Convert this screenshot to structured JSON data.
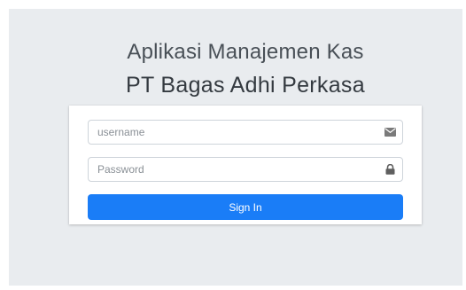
{
  "header": {
    "app_title": "Aplikasi Manajemen Kas",
    "company_name": "PT Bagas Adhi Perkasa"
  },
  "form": {
    "username": {
      "placeholder": "username",
      "value": "",
      "icon": "envelope-icon"
    },
    "password": {
      "placeholder": "Password",
      "value": "",
      "icon": "lock-icon"
    },
    "submit_label": "Sign In"
  },
  "colors": {
    "background": "#e9ecef",
    "button": "#1a7df7",
    "button_text": "#ffffff"
  }
}
